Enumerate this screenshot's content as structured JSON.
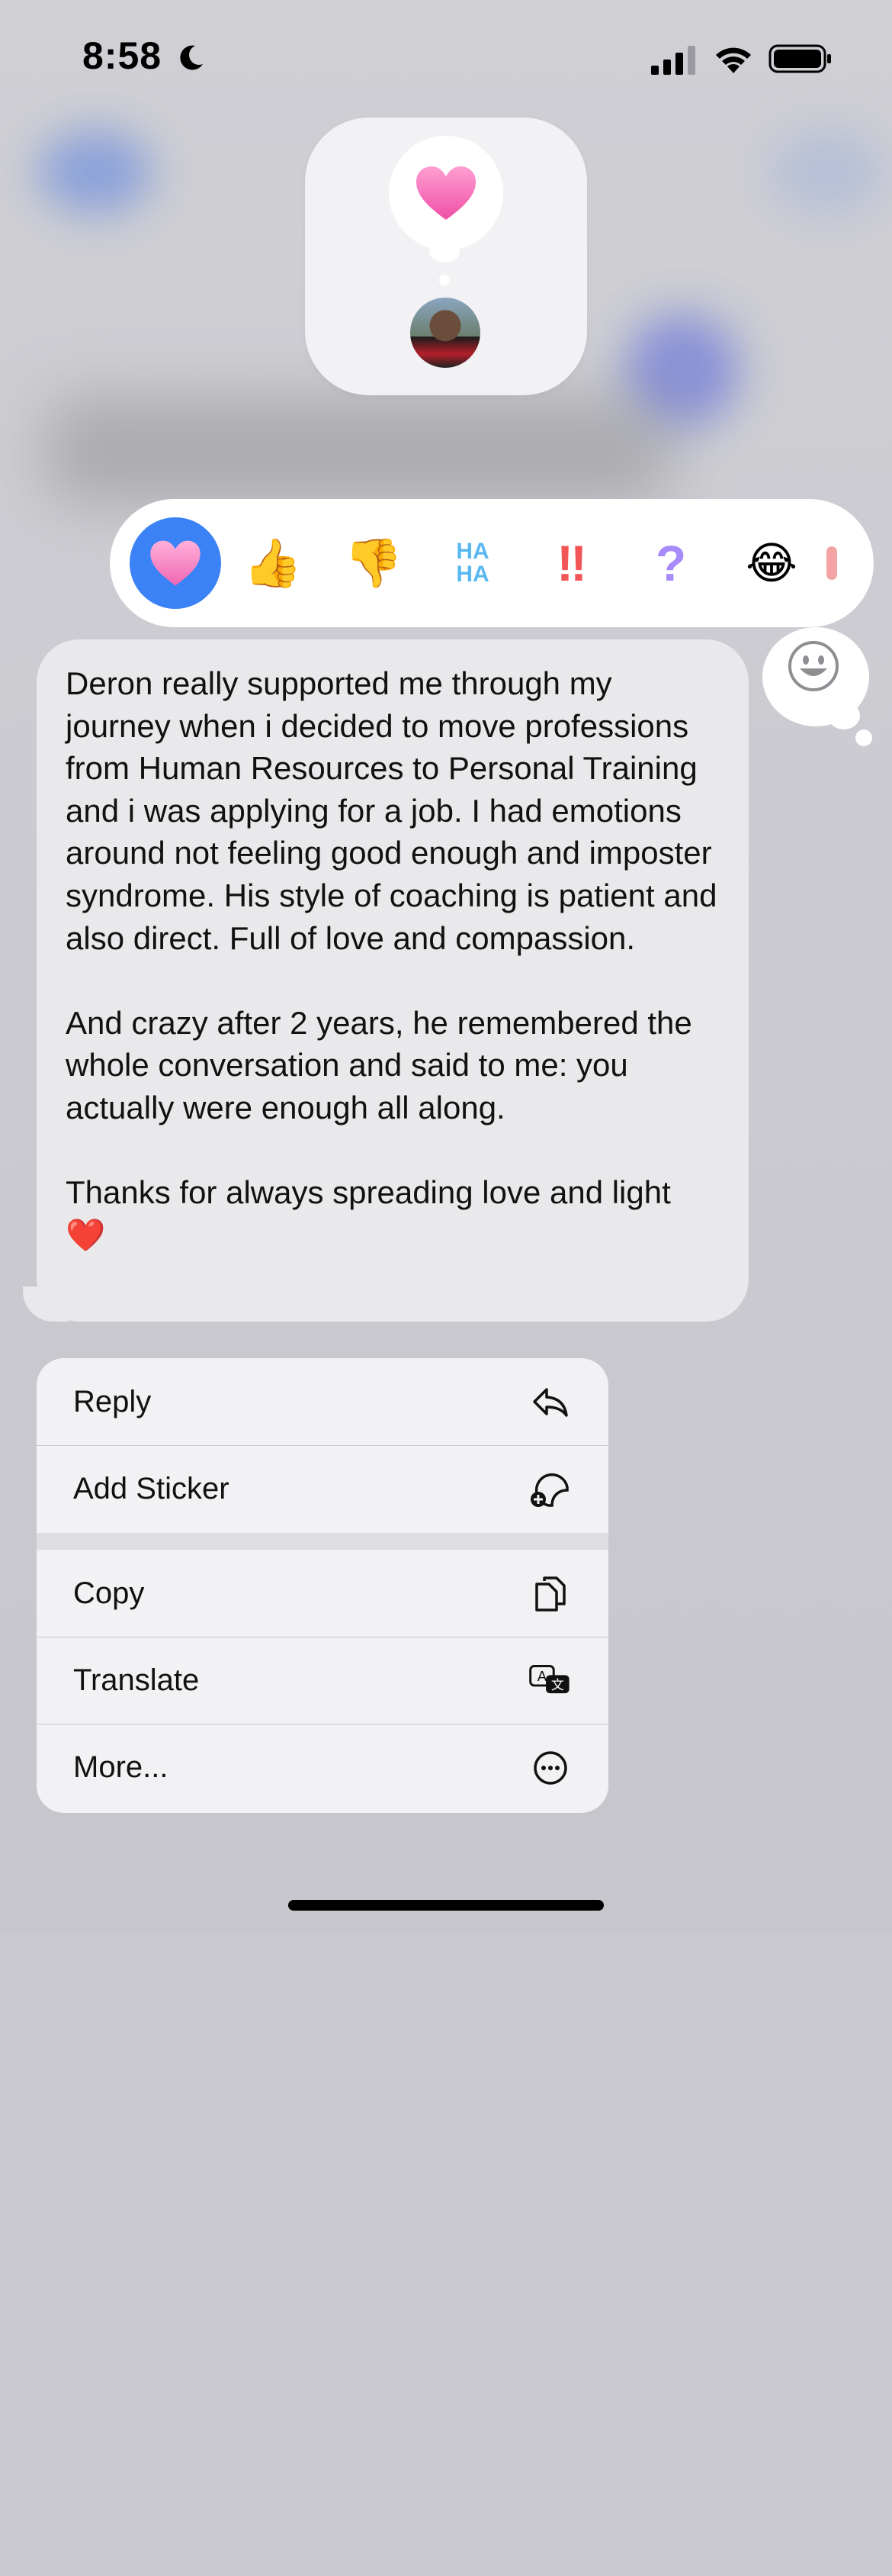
{
  "status_bar": {
    "time": "8:58",
    "icons": [
      "moon-icon",
      "cellular-signal-icon",
      "wifi-icon",
      "battery-icon"
    ]
  },
  "tapback_preview": {
    "reaction_icon": "heart-icon",
    "reactor_avatar": "avatar"
  },
  "reactions": [
    {
      "name": "heart",
      "glyph": "♥",
      "selected": true
    },
    {
      "name": "thumbs-up",
      "glyph": "👍",
      "selected": false
    },
    {
      "name": "thumbs-down",
      "glyph": "👎",
      "selected": false
    },
    {
      "name": "haha",
      "glyph": "HA HA",
      "selected": false
    },
    {
      "name": "exclamation",
      "glyph": "‼",
      "selected": false
    },
    {
      "name": "question",
      "glyph": "?",
      "selected": false
    },
    {
      "name": "laughing",
      "glyph": "😂",
      "selected": false
    }
  ],
  "message": {
    "text": "Deron really supported me through my journey when i decided to move professions from Human Resources to Personal Training and i was applying for a job. I had emotions around not feeling good enough and imposter syndrome. His style of coaching is patient and also direct. Full of love and compassion.\n\nAnd crazy after 2 years, he remembered the whole conversation and said to me: you actually were enough all along.\n\nThanks for always spreading love and light ❤️"
  },
  "menu": {
    "reply": "Reply",
    "add_sticker": "Add Sticker",
    "copy": "Copy",
    "translate": "Translate",
    "more": "More..."
  },
  "colors": {
    "accent": "#3B82F6",
    "heart": "#F472B6",
    "bubble": "#E9E9EB",
    "menu_bg": "#F2F2F4"
  }
}
